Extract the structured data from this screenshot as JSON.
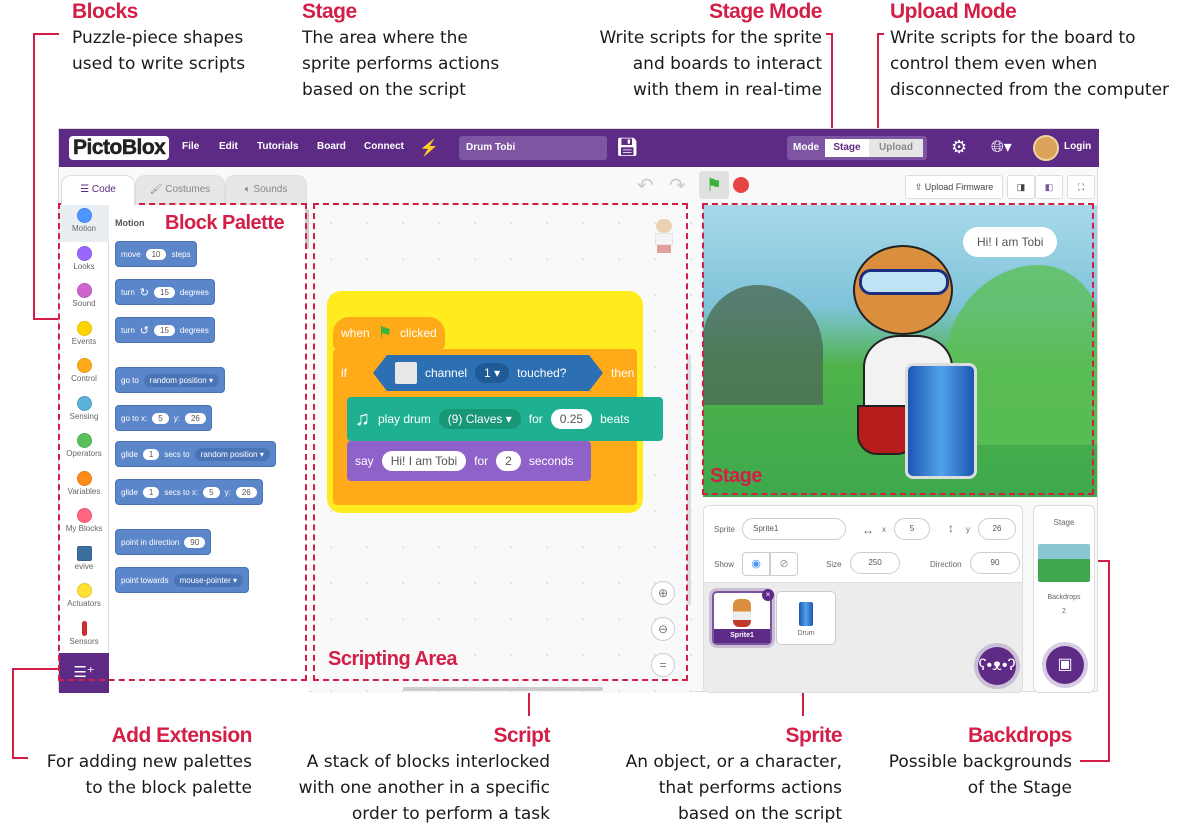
{
  "annotations": {
    "blocks": {
      "title": "Blocks",
      "desc": "Puzzle-piece shapes\nused to write scripts"
    },
    "stage": {
      "title": "Stage",
      "desc": "The area where the\nsprite performs actions\nbased on the script"
    },
    "stage_mode": {
      "title": "Stage Mode",
      "desc": "Write scripts for the sprite\nand boards to interact\nwith them in real-time"
    },
    "upload_mode": {
      "title": "Upload Mode",
      "desc": "Write scripts for the board to\ncontrol them even when\ndisconnected from the computer"
    },
    "add_extension": {
      "title": "Add Extension",
      "desc": "For adding new palettes\nto the block palette"
    },
    "script": {
      "title": "Script",
      "desc": "A stack of blocks interlocked\nwith one another in a specific\norder to perform a task"
    },
    "sprite": {
      "title": "Sprite",
      "desc": "An object, or a character,\nthat performs actions\nbased on the script"
    },
    "backdrops": {
      "title": "Backdrops",
      "desc": "Possible backgrounds\nof the Stage"
    }
  },
  "region_labels": {
    "block_palette": "Block Palette",
    "scripting_area": "Scripting Area",
    "stage": "Stage"
  },
  "menubar": {
    "logo": "PictoBlox",
    "menu": [
      "File",
      "Edit",
      "Tutorials",
      "Board",
      "Connect"
    ],
    "project_title": "Drum Tobi",
    "mode_label": "Mode",
    "mode_stage": "Stage",
    "mode_upload": "Upload",
    "login": "Login"
  },
  "tabs": [
    "Code",
    "Costumes",
    "Sounds"
  ],
  "toolbar": {
    "upload_firmware": "Upload Firmware"
  },
  "categories": [
    {
      "label": "Motion",
      "color": "#4c97ff"
    },
    {
      "label": "Looks",
      "color": "#9966ff"
    },
    {
      "label": "Sound",
      "color": "#cf63cf"
    },
    {
      "label": "Events",
      "color": "#ffd500"
    },
    {
      "label": "Control",
      "color": "#ffab19"
    },
    {
      "label": "Sensing",
      "color": "#5cb1d6"
    },
    {
      "label": "Operators",
      "color": "#59c059"
    },
    {
      "label": "Variables",
      "color": "#ff8c1a"
    },
    {
      "label": "My Blocks",
      "color": "#ff6680"
    },
    {
      "label": "evive",
      "color": "#3c6e9e"
    },
    {
      "label": "Actuators",
      "color": "#ffe033"
    },
    {
      "label": "Sensors",
      "color": "#d32f2f"
    }
  ],
  "palette": {
    "title": "Motion",
    "blocks": [
      {
        "parts": [
          "move",
          {
            "in": "10"
          },
          "steps"
        ]
      },
      {
        "parts": [
          "turn",
          {
            "icon": "↻"
          },
          {
            "in": "15"
          },
          "degrees"
        ]
      },
      {
        "parts": [
          "turn",
          {
            "icon": "↺"
          },
          {
            "in": "15"
          },
          "degrees"
        ]
      },
      {
        "parts": [
          "go to",
          {
            "drop": "random position"
          }
        ]
      },
      {
        "parts": [
          "go to x:",
          {
            "in": "5"
          },
          "y:",
          {
            "in": "26"
          }
        ]
      },
      {
        "parts": [
          "glide",
          {
            "in": "1"
          },
          "secs to",
          {
            "drop": "random position"
          }
        ]
      },
      {
        "parts": [
          "glide",
          {
            "in": "1"
          },
          "secs to x:",
          {
            "in": "5"
          },
          "y:",
          {
            "in": "26"
          }
        ]
      },
      {
        "parts": [
          "point in direction",
          {
            "in": "90"
          }
        ]
      },
      {
        "parts": [
          "point towards",
          {
            "drop": "mouse-pointer"
          }
        ]
      }
    ]
  },
  "script": {
    "hat": {
      "when": "when",
      "clicked": "clicked"
    },
    "if": {
      "if": "if",
      "channel": "channel",
      "channel_value": "1",
      "touched": "touched?",
      "then": "then"
    },
    "play_drum": {
      "label": "play drum",
      "drum": "(9) Claves",
      "for": "for",
      "beats_value": "0.25",
      "beats": "beats"
    },
    "say": {
      "label": "say",
      "text": "Hi! I am Tobi",
      "for": "for",
      "secs_value": "2",
      "seconds": "seconds"
    }
  },
  "stage": {
    "speech": "Hi! I am Tobi"
  },
  "sprite_info": {
    "sprite_label": "Sprite",
    "sprite_name": "Sprite1",
    "x_label": "x",
    "x": "5",
    "y_label": "y",
    "y": "26",
    "show_label": "Show",
    "size_label": "Size",
    "size": "250",
    "direction_label": "Direction",
    "direction": "90"
  },
  "sprites": [
    "Sprite1",
    "Drum"
  ],
  "stage_pane": {
    "title": "Stage",
    "backdrops_label": "Backdrops",
    "backdrops_count": "2"
  }
}
